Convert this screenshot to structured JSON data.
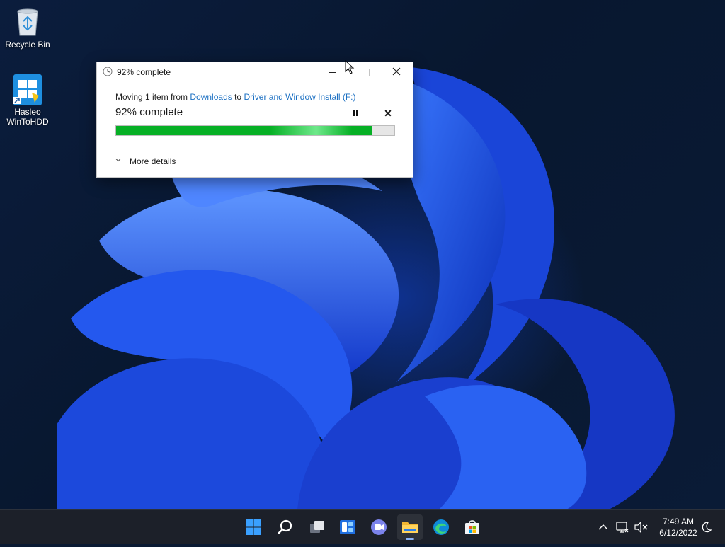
{
  "desktop": {
    "icons": [
      {
        "label": "Recycle Bin",
        "icon": "recycle-bin-icon"
      },
      {
        "label_line1": "Hasleo",
        "label_line2": "WinToHDD",
        "icon": "hasleo-wintohdd-icon"
      }
    ]
  },
  "dialog": {
    "title": "92% complete",
    "title_icon": "clock-icon",
    "moving_prefix": "Moving 1 item from ",
    "source_link": "Downloads",
    "moving_to": " to ",
    "destination_link": "Driver and Window Install (F:)",
    "percent_text": "92% complete",
    "progress_percent": 92,
    "more_details": "More details",
    "colors": {
      "progress": "#06b025",
      "link": "#1a6fc2"
    }
  },
  "taskbar": {
    "apps": [
      {
        "name": "start-button",
        "icon": "windows-logo-icon"
      },
      {
        "name": "search-button",
        "icon": "search-icon"
      },
      {
        "name": "task-view-button",
        "icon": "task-view-icon"
      },
      {
        "name": "widgets-button",
        "icon": "widgets-icon"
      },
      {
        "name": "chat-button",
        "icon": "teams-chat-icon"
      },
      {
        "name": "file-explorer-button",
        "icon": "folder-icon",
        "active": true
      },
      {
        "name": "edge-button",
        "icon": "edge-icon"
      },
      {
        "name": "store-button",
        "icon": "store-icon"
      }
    ],
    "time": "7:49 AM",
    "date": "6/12/2022",
    "tray_icons": [
      "chevron-up-icon",
      "network-icon",
      "volume-muted-icon",
      "notifications-icon"
    ]
  }
}
